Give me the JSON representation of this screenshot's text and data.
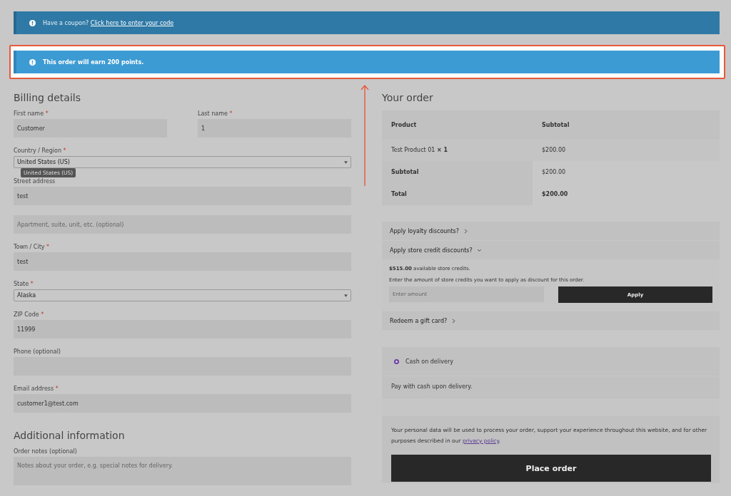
{
  "notices": [
    {
      "kind": "coupon",
      "text": "Have a coupon?",
      "link": "Click here to enter your code",
      "highlighted": false
    },
    {
      "kind": "points",
      "text": "This order will earn 200 points.",
      "highlighted": true
    }
  ],
  "billing": {
    "title": "Billing details",
    "name_row": [
      {
        "label": "First name",
        "required_mark": "*",
        "kind": "input",
        "value": "Customer"
      },
      {
        "label": "Last name",
        "required_mark": "*",
        "kind": "input",
        "value": "1"
      }
    ],
    "fields": [
      {
        "label": "Country / Region",
        "required_mark": "*",
        "kind": "select",
        "value": "United States (US)",
        "tooltip": "United States (US)"
      },
      {
        "label": "Street address",
        "kind": "input",
        "value": "test"
      },
      {
        "kind": "input",
        "placeholder": "Apartment, suite, unit, etc. (optional)"
      },
      {
        "label": "Town / City",
        "required_mark": "*",
        "kind": "input",
        "value": "test"
      },
      {
        "label": "State",
        "required_mark": "*",
        "kind": "select",
        "value": "Alaska"
      },
      {
        "label": "ZIP Code",
        "required_mark": "*",
        "kind": "input",
        "value": "11999"
      },
      {
        "label": "Phone (optional)",
        "kind": "input"
      },
      {
        "label": "Email address",
        "required_mark": "*",
        "kind": "input",
        "value": "customer1@test.com"
      }
    ]
  },
  "additional": {
    "title": "Additional information",
    "fields": [
      {
        "label": "Order notes (optional)",
        "kind": "textarea",
        "placeholder": "Notes about your order, e.g. special notes for delivery."
      }
    ]
  },
  "order": {
    "title": "Your order",
    "columns": [
      "Product",
      "Subtotal"
    ],
    "items": [
      {
        "name": "Test Product 01",
        "qty": "× 1",
        "total": "$200.00"
      }
    ],
    "totals": [
      {
        "label": "Subtotal",
        "value": "$200.00",
        "bold": false
      },
      {
        "label": "Total",
        "value": "$200.00",
        "bold": true
      }
    ]
  },
  "discounts": [
    {
      "label": "Apply loyalty discounts?",
      "expanded": false
    },
    {
      "label": "Apply store credit discounts?",
      "expanded": true,
      "available": "$515.00",
      "available_text": "available store credits.",
      "hint": "Enter the amount of store credits you want to apply as discount for this order.",
      "placeholder": "Enter amount",
      "button": "Apply"
    },
    {
      "label": "Redeem a gift card?",
      "expanded": false
    }
  ],
  "payment": {
    "methods": [
      {
        "label": "Cash on delivery",
        "selected": true,
        "description": "Pay with cash upon delivery."
      }
    ]
  },
  "privacy": {
    "text": "Your personal data will be used to process your order, support your experience throughout this website, and for other purposes described in our",
    "link": "privacy policy",
    "after": "."
  },
  "place_order": "Place order"
}
